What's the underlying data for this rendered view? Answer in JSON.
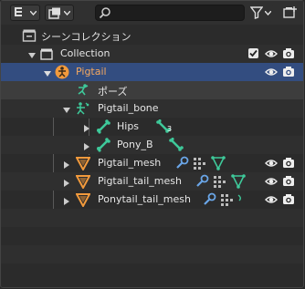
{
  "header": {
    "search": {
      "placeholder": ""
    },
    "display_mode_icon": "outliner-display-icon",
    "view_layer_icon": "view-layer-icon",
    "filter_icon": "filter-icon",
    "new_collection_icon": "new-collection-icon"
  },
  "tree": {
    "scene_collection": {
      "label": "シーンコレクション",
      "icon": "scene-collection-icon"
    },
    "collection": {
      "label": "Collection",
      "icon": "collection-icon"
    },
    "pigtail": {
      "label": "Pigtail",
      "icon": "armature-object-icon"
    },
    "pose": {
      "label": "ポーズ",
      "icon": "pose-icon"
    },
    "pigtail_bone": {
      "label": "Pigtail_bone",
      "icon": "armature-data-icon"
    },
    "hips": {
      "label": "Hips",
      "icon": "bone-icon",
      "child_count": "3"
    },
    "pony_b": {
      "label": "Pony_B",
      "icon": "bone-icon"
    },
    "pigtail_mesh": {
      "label": "Pigtail_mesh",
      "icon": "mesh-object-icon"
    },
    "pigtail_tail_mesh": {
      "label": "Pigtail_tail_mesh",
      "icon": "mesh-object-icon"
    },
    "ponytail_tail_mesh": {
      "label": "Ponytail_tail_mesh",
      "icon": "mesh-object-icon"
    }
  },
  "colors": {
    "selected_row": "#334d80",
    "active_text": "#f4a860",
    "bone": "#3ec99a",
    "object_orange": "#f29a3c",
    "modifier_blue": "#6aa6e8"
  }
}
